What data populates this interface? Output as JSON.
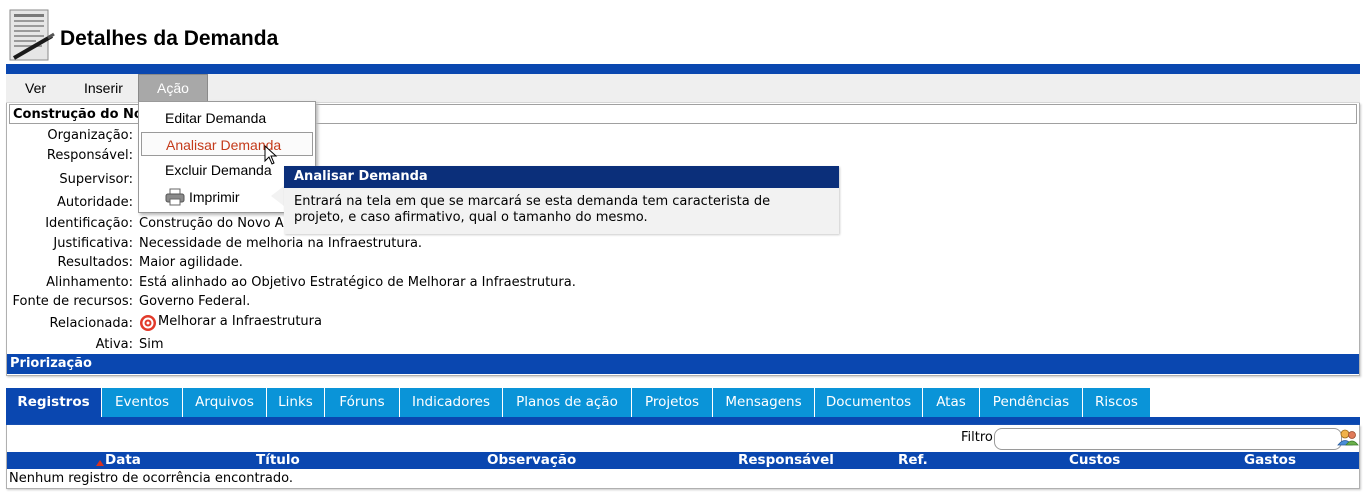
{
  "page": {
    "title": "Detalhes da Demanda"
  },
  "menu": {
    "items": [
      "Ver",
      "Inserir",
      "Ação"
    ]
  },
  "dropdown": {
    "items": [
      "Editar Demanda",
      "Analisar Demanda",
      "Excluir Demanda",
      "Imprimir"
    ]
  },
  "details": {
    "title": "Construção do No",
    "fields": [
      {
        "label": "Organização:",
        "value": ""
      },
      {
        "label": "Responsável:",
        "value": ""
      },
      {
        "label": "Supervisor:",
        "value": ""
      },
      {
        "label": "Autoridade:",
        "value": ""
      },
      {
        "label": "Identificação:",
        "value": "Construção do Novo Anexo"
      },
      {
        "label": "Justificativa:",
        "value": "Necessidade de melhoria na Infraestrutura."
      },
      {
        "label": "Resultados:",
        "value": "Maior agilidade."
      },
      {
        "label": "Alinhamento:",
        "value": "Está alinhado ao Objetivo Estratégico de Melhorar a Infraestrutura."
      },
      {
        "label": "Fonte de recursos:",
        "value": "Governo Federal."
      },
      {
        "label": "Relacionada:",
        "value": "Melhorar a Infraestrutura"
      },
      {
        "label": "Ativa:",
        "value": "Sim"
      }
    ],
    "section": "Priorização"
  },
  "tooltip": {
    "title": "Analisar Demanda",
    "line1": "Entrará na tela em que se marcará se esta demanda tem caracterista de",
    "line2": "projeto, e caso afirmativo, qual o tamanho do mesmo."
  },
  "tabs": [
    "Registros",
    "Eventos",
    "Arquivos",
    "Links",
    "Fóruns",
    "Indicadores",
    "Planos de ação",
    "Projetos",
    "Mensagens",
    "Documentos",
    "Atas",
    "Pendências",
    "Riscos"
  ],
  "list": {
    "filter_label": "Filtro",
    "filter_value": "",
    "columns": [
      "Data",
      "Título",
      "Observação",
      "Responsável",
      "Ref.",
      "Custos",
      "Gastos"
    ],
    "empty_message": "Nenhum registro de ocorrência encontrado."
  },
  "colors": {
    "primary": "#0a47b0",
    "tab": "#0a94d8",
    "tooltip_head": "#0b2f7a",
    "hover_text": "#c43a1a"
  }
}
